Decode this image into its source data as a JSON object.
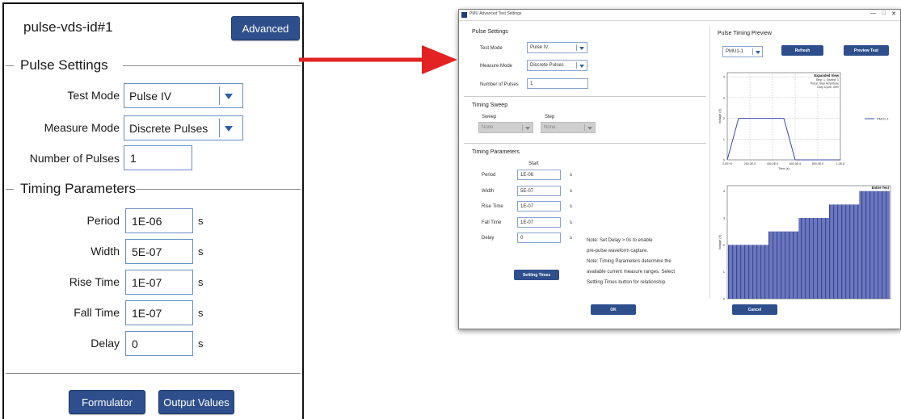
{
  "left": {
    "title": "pulse-vds-id#1",
    "advanced_label": "Advanced",
    "pulse_settings": {
      "heading": "Pulse Settings",
      "test_mode": {
        "label": "Test Mode",
        "value": "Pulse IV"
      },
      "measure_mode": {
        "label": "Measure Mode",
        "value": "Discrete Pulses"
      },
      "num_pulses": {
        "label": "Number of Pulses",
        "value": "1"
      }
    },
    "timing_parameters": {
      "heading": "Timing Parameters",
      "rows": [
        {
          "label": "Period",
          "value": "1E-06",
          "unit": "s"
        },
        {
          "label": "Width",
          "value": "5E-07",
          "unit": "s"
        },
        {
          "label": "Rise Time",
          "value": "1E-07",
          "unit": "s"
        },
        {
          "label": "Fall Time",
          "value": "1E-07",
          "unit": "s"
        },
        {
          "label": "Delay",
          "value": "0",
          "unit": "s"
        }
      ]
    },
    "formulator_label": "Formulator",
    "output_values_label": "Output Values"
  },
  "dialog": {
    "title": "PMU Advanced Test Settings",
    "pulse_settings": {
      "heading": "Pulse Settings",
      "test_mode": {
        "label": "Test Mode",
        "value": "Pulse IV"
      },
      "measure_mode": {
        "label": "Measure Mode",
        "value": "Discrete Pulses"
      },
      "num_pulses": {
        "label": "Number of Pulses",
        "value": "1"
      }
    },
    "timing_sweep": {
      "heading": "Timing Sweep",
      "sweep": {
        "label": "Sweep",
        "value": "None"
      },
      "step": {
        "label": "Step",
        "value": "None"
      }
    },
    "timing_parameters": {
      "heading": "Timing Parameters",
      "column_header": "Start",
      "rows": [
        {
          "label": "Period",
          "value": "1E-06",
          "unit": "s"
        },
        {
          "label": "Width",
          "value": "5E-07",
          "unit": "s"
        },
        {
          "label": "Rise Time",
          "value": "1E-07",
          "unit": "s"
        },
        {
          "label": "Fall Time",
          "value": "1E-07",
          "unit": "s"
        },
        {
          "label": "Delay",
          "value": "0",
          "unit": "s"
        }
      ],
      "settling_times_label": "Settling Times",
      "notes": [
        "Note: Set Delay > 0s to enable",
        "pre-pulse waveform capture.",
        "Note: Timing Parameters determine the",
        "available current measure ranges. Select",
        "Settling Times button for relationship."
      ]
    },
    "preview": {
      "heading": "Pulse Timing Preview",
      "channel": "PMU1-1",
      "refresh_label": "Refresh",
      "preview_test_label": "Preview Test"
    },
    "ok_label": "OK",
    "cancel_label": "Cancel"
  },
  "chart_data": [
    {
      "type": "line",
      "title": "Expanded View",
      "annotations": [
        "Step: 1, Sweep: 1",
        "Pulse: Step Amplitude",
        "Duty Cycle: 40%"
      ],
      "xlabel": "Time (s)",
      "ylabel": "Voltage (V)",
      "x_tick_labels": [
        "0.0E+0",
        "200.0E-9",
        "400.0E-9",
        "600.0E-9",
        "800.0E-9",
        "1.0E-6"
      ],
      "y_tick_labels": [
        "0",
        "1",
        "2",
        "3",
        "4"
      ],
      "xlim": [
        0,
        1e-06
      ],
      "ylim": [
        0,
        4.2
      ],
      "series": [
        {
          "name": "PMU1-1",
          "x": [
            0,
            1e-07,
            5e-07,
            6e-07,
            1e-06
          ],
          "y": [
            0,
            2,
            2,
            0,
            0
          ]
        }
      ],
      "legend": "right",
      "grid": true
    },
    {
      "type": "bar",
      "title": "Entire Test",
      "ylabel": "Voltage (V)",
      "y_tick_labels": [
        "0",
        "1",
        "2",
        "3",
        "4"
      ],
      "ylim": [
        0,
        4.2
      ],
      "values": [
        2,
        2,
        2,
        2,
        2,
        2,
        2,
        2,
        2,
        2,
        2,
        2,
        2,
        2,
        2,
        2,
        2,
        2,
        2,
        2,
        2,
        2,
        2,
        2,
        2,
        2,
        2,
        2,
        2,
        2,
        2,
        2,
        2,
        2,
        2,
        2,
        2,
        2,
        2,
        2,
        2.5,
        2.5,
        2.5,
        2.5,
        2.5,
        2.5,
        2.5,
        2.5,
        2.5,
        2.5,
        2.5,
        2.5,
        2.5,
        2.5,
        2.5,
        2.5,
        2.5,
        2.5,
        2.5,
        2.5,
        2.5,
        2.5,
        2.5,
        2.5,
        2.5,
        2.5,
        2.5,
        2.5,
        2.5,
        2.5,
        3,
        3,
        3,
        3,
        3,
        3,
        3,
        3,
        3,
        3,
        3,
        3,
        3,
        3,
        3,
        3,
        3,
        3,
        3,
        3,
        3,
        3,
        3,
        3,
        3,
        3,
        3,
        3,
        3,
        3,
        3.5,
        3.5,
        3.5,
        3.5,
        3.5,
        3.5,
        3.5,
        3.5,
        3.5,
        3.5,
        3.5,
        3.5,
        3.5,
        3.5,
        3.5,
        3.5,
        3.5,
        3.5,
        3.5,
        3.5,
        3.5,
        3.5,
        3.5,
        3.5,
        3.5,
        3.5,
        3.5,
        3.5,
        3.5,
        3.5,
        4,
        4,
        4,
        4,
        4,
        4,
        4,
        4,
        4,
        4,
        4,
        4,
        4,
        4,
        4,
        4,
        4,
        4,
        4,
        4,
        4,
        4,
        4,
        4,
        4,
        4,
        4,
        4,
        4,
        4
      ],
      "grid": false
    }
  ],
  "colors": {
    "accent": "#2e4f8c",
    "arrow": "#e32222",
    "waveform": "#3b4aa8",
    "bars": "#2f3f9e"
  }
}
